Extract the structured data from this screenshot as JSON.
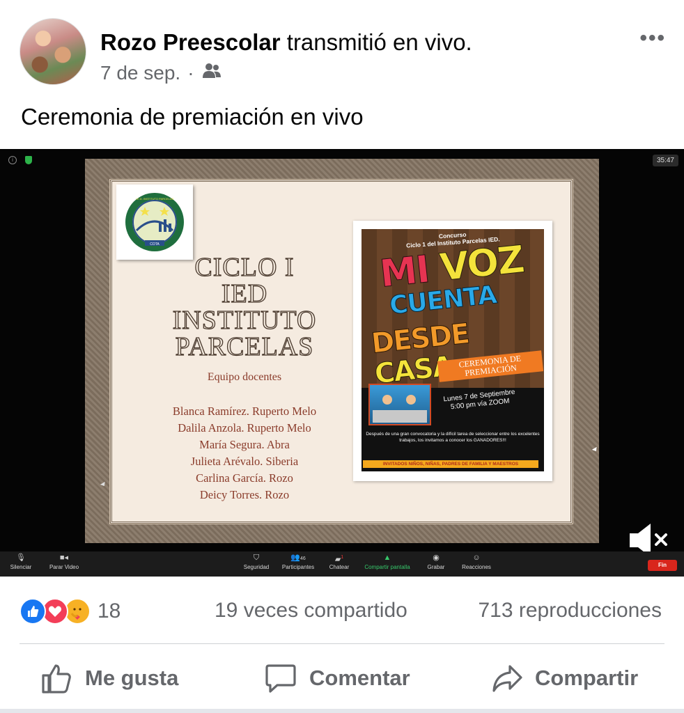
{
  "post": {
    "author": "Rozo Preescolar",
    "action": " transmitió en vivo.",
    "date": "7 de sep.",
    "separator": "·",
    "audience_icon": "friends-icon",
    "more_label": "•••",
    "text": "Ceremonia de premiación en vivo"
  },
  "video": {
    "timer": "35:47",
    "slide": {
      "title_lines": [
        "CICLO I",
        "IED",
        "INSTITUTO",
        "PARCELAS"
      ],
      "team_label": "Equipo docentes",
      "teachers": [
        "Blanca Ramírez. Ruperto Melo",
        "Dalila Anzola. Ruperto Melo",
        "María Segura. Abra",
        "Julieta Arévalo. Siberia",
        "Carlina García. Rozo",
        "Deicy Torres. Rozo"
      ],
      "logo_text": "I.E.D. INSTITUTO PARCELAS",
      "logo_bottom": "COTA",
      "poster": {
        "concurso": "Concurso",
        "ciclo": "Ciclo 1 del Instituto Parcelas IED.",
        "mi": "MI",
        "voz": "VOZ",
        "cuenta": "CUENTA",
        "desde": "DESDE",
        "casa": "CASA",
        "ceremonia": "CEREMONIA DE PREMIACIÓN",
        "date_line1": "Lunes 7 de Septiembre",
        "date_line2": "5:00 pm vía ZOOM",
        "body": "Después de una gran convocatoria y la difícil tarea de seleccionar entre los excelentes trabajos, los invitamos a conocer los GANADORES!!!",
        "footer": "INVITADOS NIÑOS, NIÑAS, PADRES DE FAMILIA Y MAESTROS"
      }
    },
    "zoom_bar": {
      "mute": "Silenciar",
      "video": "Parar Video",
      "security": "Seguridad",
      "participants": "Participantes",
      "participants_count": "46",
      "chat": "Chatear",
      "chat_badge": "1",
      "share": "Compartir pantalla",
      "record": "Grabar",
      "reactions": "Reacciones",
      "end": "Fin"
    }
  },
  "stats": {
    "reaction_icons": [
      "like-icon",
      "love-icon",
      "care-icon"
    ],
    "reaction_count": "18",
    "shares": "19 veces compartido",
    "views": "713 reproducciones"
  },
  "actions": {
    "like": "Me gusta",
    "comment": "Comentar",
    "share": "Compartir"
  },
  "colors": {
    "facebook_blue": "#1877f2",
    "love_red": "#f33e58",
    "care_yellow": "#f7b125",
    "secondary_text": "#65676b",
    "zoom_share_green": "#37c86b",
    "zoom_end_red": "#d9261c"
  }
}
